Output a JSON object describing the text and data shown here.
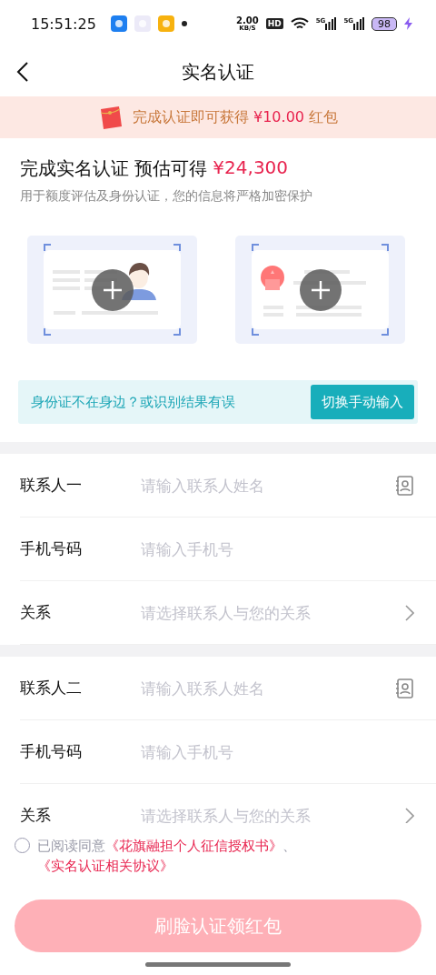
{
  "status_bar": {
    "time": "15:51:25",
    "speed_value": "2.00",
    "speed_unit": "KB/S",
    "hd": "HD",
    "networks": [
      "5G",
      "5G"
    ],
    "battery": "98"
  },
  "nav": {
    "title": "实名认证"
  },
  "banner": {
    "text": "完成认证即可获得",
    "amount": "¥10.00",
    "suffix": "红包"
  },
  "intro": {
    "title": "完成实名认证 预估可得",
    "amount": "¥24,300",
    "subtitle": "用于额度评估及身份认证，您的信息将严格加密保护"
  },
  "id_cards": [
    {
      "kind": "portrait"
    },
    {
      "kind": "emblem"
    }
  ],
  "help_bar": {
    "text": "身份证不在身边？或识别结果有误",
    "button": "切换手动输入"
  },
  "contact_groups": [
    {
      "rows": [
        {
          "kind": "contact",
          "label": "联系人一",
          "placeholder": "请输入联系人姓名"
        },
        {
          "kind": "phone",
          "label": "手机号码",
          "placeholder": "请输入手机号"
        },
        {
          "kind": "select",
          "label": "关系",
          "placeholder": "请选择联系人与您的关系"
        }
      ]
    },
    {
      "rows": [
        {
          "kind": "contact",
          "label": "联系人二",
          "placeholder": "请输入联系人姓名"
        },
        {
          "kind": "phone",
          "label": "手机号码",
          "placeholder": "请输入手机号"
        },
        {
          "kind": "select",
          "label": "关系",
          "placeholder": "请选择联系人与您的关系"
        }
      ]
    }
  ],
  "agreement": {
    "checked": false,
    "text": "已阅读同意",
    "links": [
      "《花旗融担个人征信授权书》",
      "《实名认证相关协议》"
    ],
    "separator": "、"
  },
  "submit": {
    "label": "刷脸认证领红包",
    "disabled": true
  }
}
